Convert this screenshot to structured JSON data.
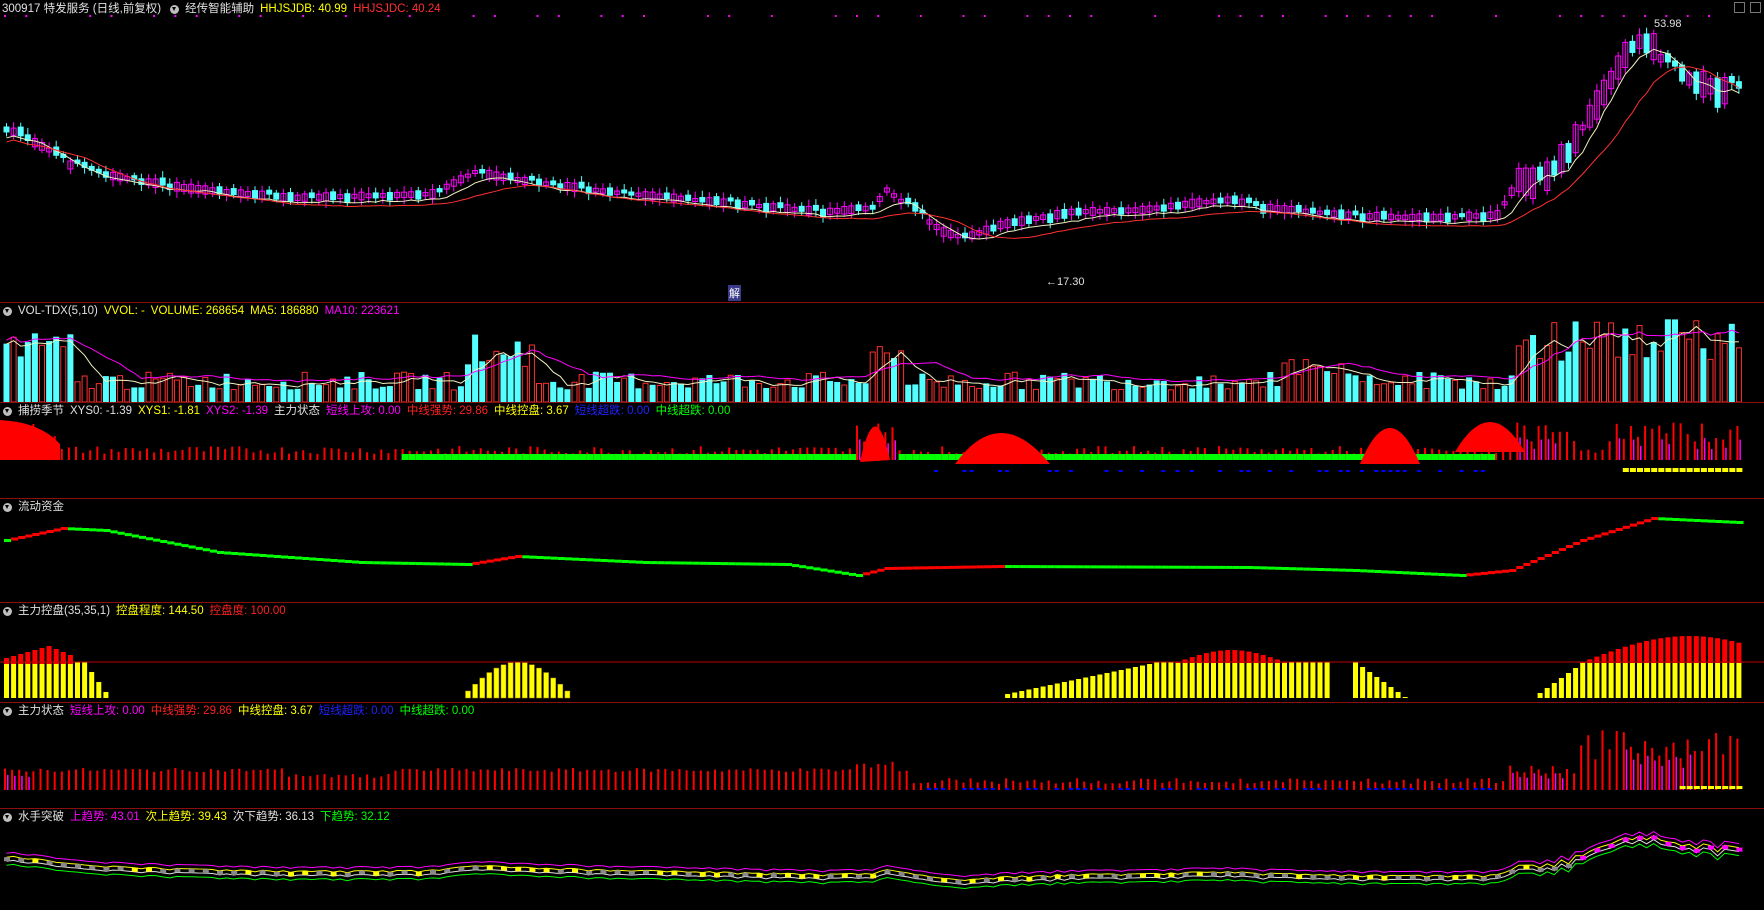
{
  "main": {
    "title": "300917 特发服务 (日线,前复权)",
    "indicator": "经传智能辅助",
    "hhjsjdb_label": "HHJSJDB: 40.99",
    "hhjsjdc_label": "HHJSJDC: 40.24",
    "high_label": "53.98",
    "low_label": "17.30",
    "marker_jie": "解"
  },
  "vol": {
    "name": "VOL-TDX(5,10)",
    "vvol": "VVOL: -",
    "volume": "VOLUME: 268654",
    "ma5": "MA5: 186880",
    "ma10": "MA10: 223621"
  },
  "season": {
    "name": "捕捞季节",
    "xys0": "XYS0: -1.39",
    "xys1": "XYS1: -1.81",
    "xys2": "XYS2: -1.39",
    "state": "主力状态",
    "s1": "短线上攻: 0.00",
    "s2": "中线强势: 29.86",
    "s3": "中线控盘: 3.67",
    "s4": "短线超跌: 0.00",
    "s5": "中线超跌: 0.00"
  },
  "flow": {
    "name": "流动资金"
  },
  "control": {
    "name": "主力控盘(35,35,1)",
    "degree": "控盘程度: 144.50",
    "level": "控盘度: 100.00"
  },
  "state": {
    "name": "主力状态",
    "s1": "短线上攻: 0.00",
    "s2": "中线强势: 29.86",
    "s3": "中线控盘: 3.67",
    "s4": "短线超跌: 0.00",
    "s5": "中线超跌: 0.00"
  },
  "sailor": {
    "name": "水手突破",
    "up": "上趋势: 43.01",
    "up2": "次上趋势: 39.43",
    "down2": "次下趋势: 36.13",
    "down": "下趋势: 32.12"
  },
  "colors": {
    "up": "#ff00ff",
    "down": "#54ffff",
    "red": "#ff0000",
    "yellow": "#ffff00",
    "green": "#00ff00",
    "blue": "#0000ff",
    "grid_line": "#8a1010"
  }
}
